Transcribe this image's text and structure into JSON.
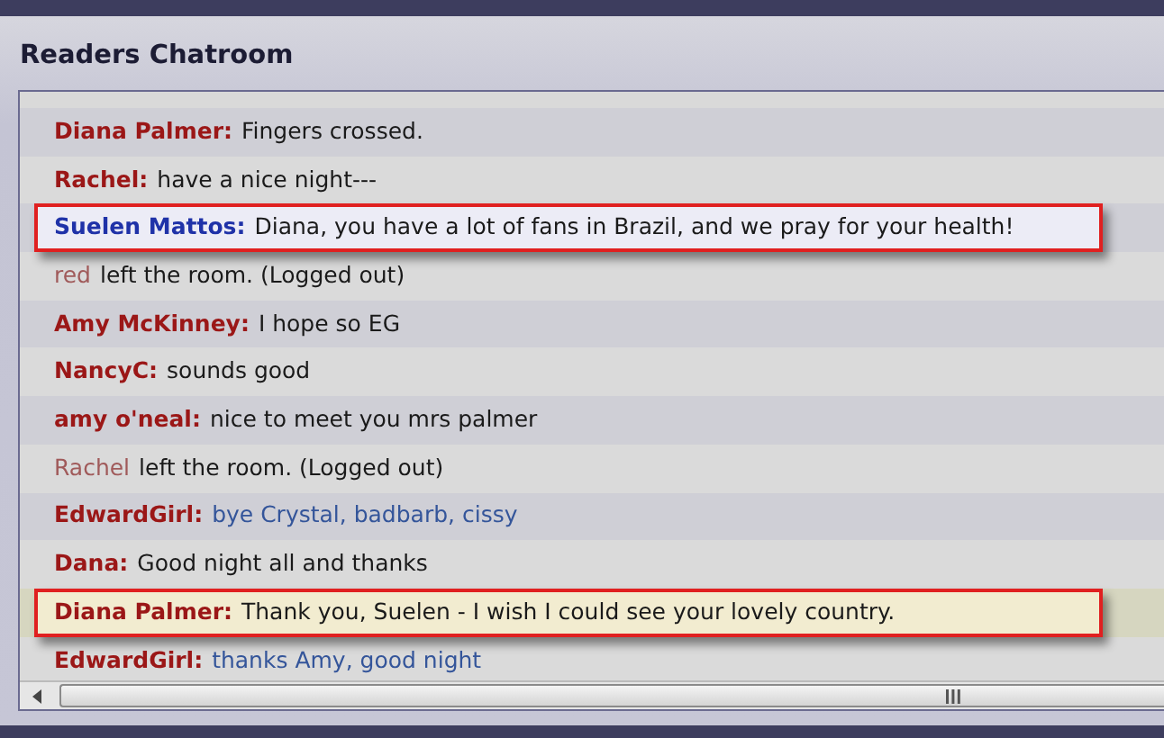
{
  "title": "Readers Chatroom",
  "messages": [
    {
      "kind": "message",
      "user": "Diana Palmer:",
      "text": "Fingers crossed.",
      "color": "#9b1717",
      "accent": false,
      "highlighted": false,
      "author_reply": false
    },
    {
      "kind": "message",
      "user": "Rachel:",
      "text": "have a nice night---",
      "color": "#9b1717",
      "accent": false,
      "highlighted": false,
      "author_reply": false
    },
    {
      "kind": "message",
      "user": "Suelen Mattos:",
      "text": "Diana, you have a lot of fans in Brazil, and we pray for your health!",
      "color": "#1f32a8",
      "accent": false,
      "highlighted": true,
      "author_reply": false
    },
    {
      "kind": "event",
      "user": "red",
      "text": "left the room. (Logged out)",
      "color": "#a05a5a",
      "accent": false,
      "highlighted": false,
      "author_reply": false
    },
    {
      "kind": "message",
      "user": "Amy McKinney:",
      "text": "I hope so EG",
      "color": "#9b1717",
      "accent": false,
      "highlighted": false,
      "author_reply": false
    },
    {
      "kind": "message",
      "user": "NancyC:",
      "text": "sounds good",
      "color": "#9b1717",
      "accent": false,
      "highlighted": false,
      "author_reply": false
    },
    {
      "kind": "message",
      "user": "amy o'neal:",
      "text": "nice to meet you mrs palmer",
      "color": "#9b1717",
      "accent": false,
      "highlighted": false,
      "author_reply": false
    },
    {
      "kind": "event",
      "user": "Rachel",
      "text": "left the room. (Logged out)",
      "color": "#a05a5a",
      "accent": false,
      "highlighted": false,
      "author_reply": false
    },
    {
      "kind": "message",
      "user": "EdwardGirl:",
      "text": "bye Crystal, badbarb, cissy",
      "color": "#9b1717",
      "accent": true,
      "highlighted": false,
      "author_reply": false
    },
    {
      "kind": "message",
      "user": "Dana:",
      "text": "Good night all and thanks",
      "color": "#9b1717",
      "accent": false,
      "highlighted": false,
      "author_reply": false
    },
    {
      "kind": "message",
      "user": "Diana Palmer:",
      "text": "Thank you, Suelen - I wish I could see your lovely country.",
      "color": "#9b1717",
      "accent": false,
      "highlighted": true,
      "author_reply": true
    },
    {
      "kind": "message",
      "user": "EdwardGirl:",
      "text": "thanks Amy, good night",
      "color": "#9b1717",
      "accent": true,
      "highlighted": false,
      "author_reply": false
    }
  ]
}
